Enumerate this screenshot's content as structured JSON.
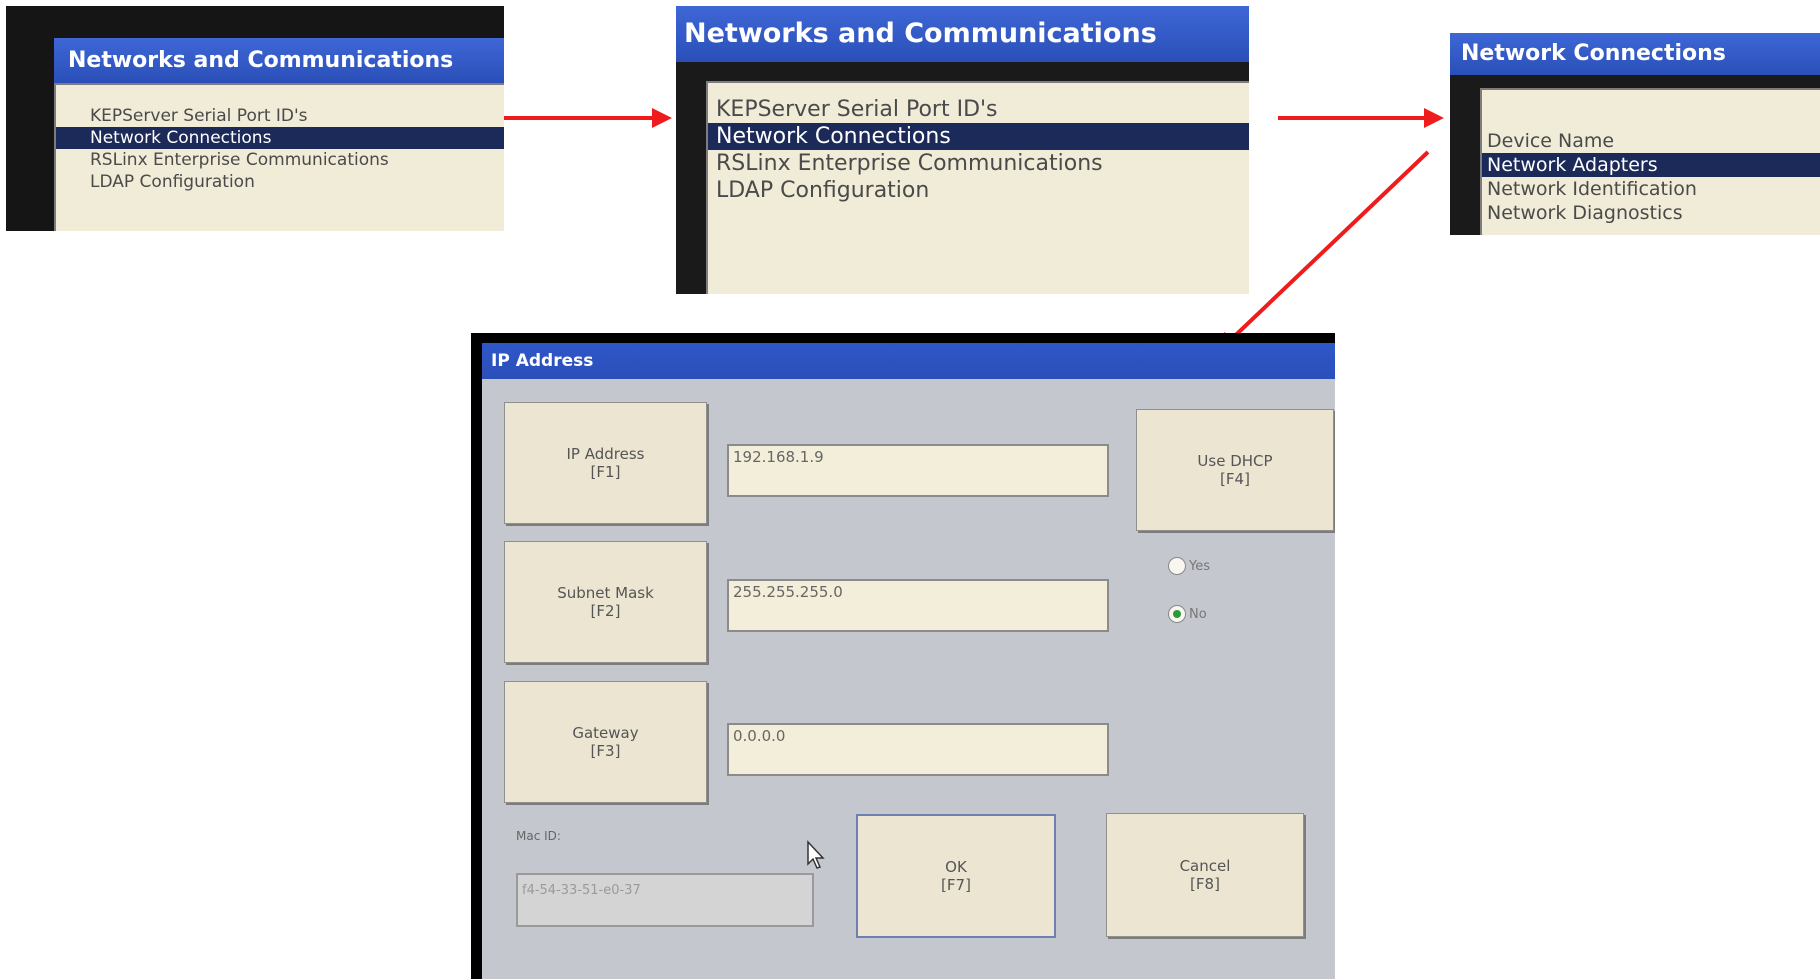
{
  "panel_a": {
    "title": "Networks and Communications",
    "items": [
      "KEPServer Serial Port ID's",
      "Network Connections",
      "RSLinx Enterprise Communications",
      "LDAP Configuration"
    ],
    "selected_index": 1
  },
  "panel_b": {
    "title": "Networks and Communications",
    "items": [
      "KEPServer Serial Port ID's",
      "Network Connections",
      "RSLinx Enterprise Communications",
      "LDAP Configuration"
    ],
    "selected_index": 1
  },
  "panel_c": {
    "title": "Network Connections",
    "items": [
      "Device Name",
      "Network Adapters",
      "Network Identification",
      "Network Diagnostics"
    ],
    "selected_index": 1
  },
  "dialog": {
    "title": "IP Address",
    "ip_button": {
      "label": "IP Address",
      "key": "[F1]"
    },
    "subnet_button": {
      "label": "Subnet Mask",
      "key": "[F2]"
    },
    "gateway_button": {
      "label": "Gateway",
      "key": "[F3]"
    },
    "dhcp_button": {
      "label": "Use DHCP",
      "key": "[F4]"
    },
    "ip_value": "192.168.1.9",
    "subnet_value": "255.255.255.0",
    "gateway_value": "0.0.0.0",
    "dhcp_yes_label": "Yes",
    "dhcp_no_label": "No",
    "dhcp_selected": "No",
    "mac_label": "Mac ID:",
    "mac_value": "f4-54-33-51-e0-37",
    "ok_button": {
      "label": "OK",
      "key": "[F7]"
    },
    "cancel_button": {
      "label": "Cancel",
      "key": "[F8]"
    }
  },
  "colors": {
    "arrow": "#ee1c1c",
    "title_bar": "#2a4fb8",
    "selection": "#1c2a59",
    "list_bg": "#f1ecd8",
    "radio_checked": "#2b9a3f"
  },
  "icons": [
    "arrow-right-icon",
    "arrow-diagonal-icon",
    "mouse-cursor-icon"
  ]
}
